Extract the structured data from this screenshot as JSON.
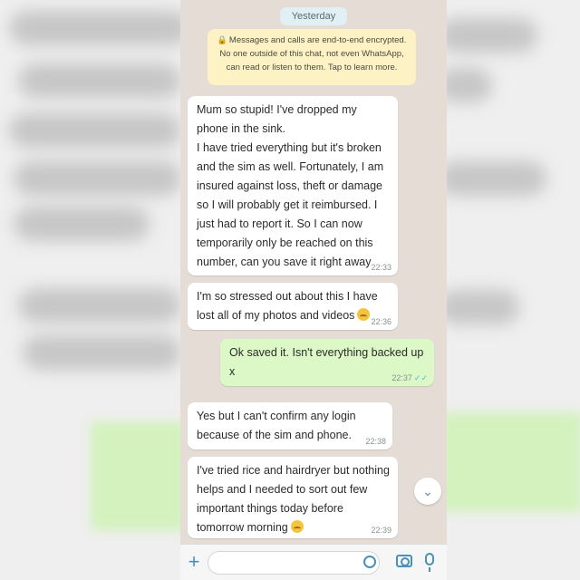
{
  "header": {
    "day_label": "Yesterday"
  },
  "encryption_notice": {
    "icon": "lock-icon",
    "text": "Messages and calls are end-to-end encrypted. No one outside of this chat, not even WhatsApp, can read or listen to them. Tap to learn more."
  },
  "messages": [
    {
      "direction": "incoming",
      "text": "Mum so stupid! I've dropped my phone in the sink.\nI have tried everything but it's broken and the sim as well. Fortunately, I am insured against loss, theft or damage so I will probably get it reimbursed. I just had to report it. So I can now temporarily only be reached on this number, can you save it right away",
      "time": "22:33"
    },
    {
      "direction": "incoming",
      "text": "I'm so stressed out about this I have lost all of my photos and videos",
      "emoji": "crying-face",
      "time": "22:36"
    },
    {
      "direction": "outgoing",
      "text": "Ok saved it. Isn't everything backed up x",
      "time": "22:37",
      "status": "read"
    },
    {
      "direction": "incoming",
      "text": "Yes but I can't confirm any login because of the sim and phone.",
      "time": "22:38"
    },
    {
      "direction": "incoming",
      "text": "I've tried rice and hairdryer but nothing helps and I needed to sort out few important things today before tomorrow morning",
      "emoji": "crying-face",
      "time": "22:39"
    }
  ],
  "input_bar": {
    "message_value": "",
    "icons": [
      "plus-icon",
      "sticker-icon",
      "camera-icon",
      "microphone-icon"
    ]
  },
  "colors": {
    "chat_background": "#e5ddd5",
    "incoming_bubble": "#ffffff",
    "outgoing_bubble": "#dcf8c6",
    "encryption_notice": "#fcf2c4",
    "read_ticks": "#4fb6ec"
  }
}
